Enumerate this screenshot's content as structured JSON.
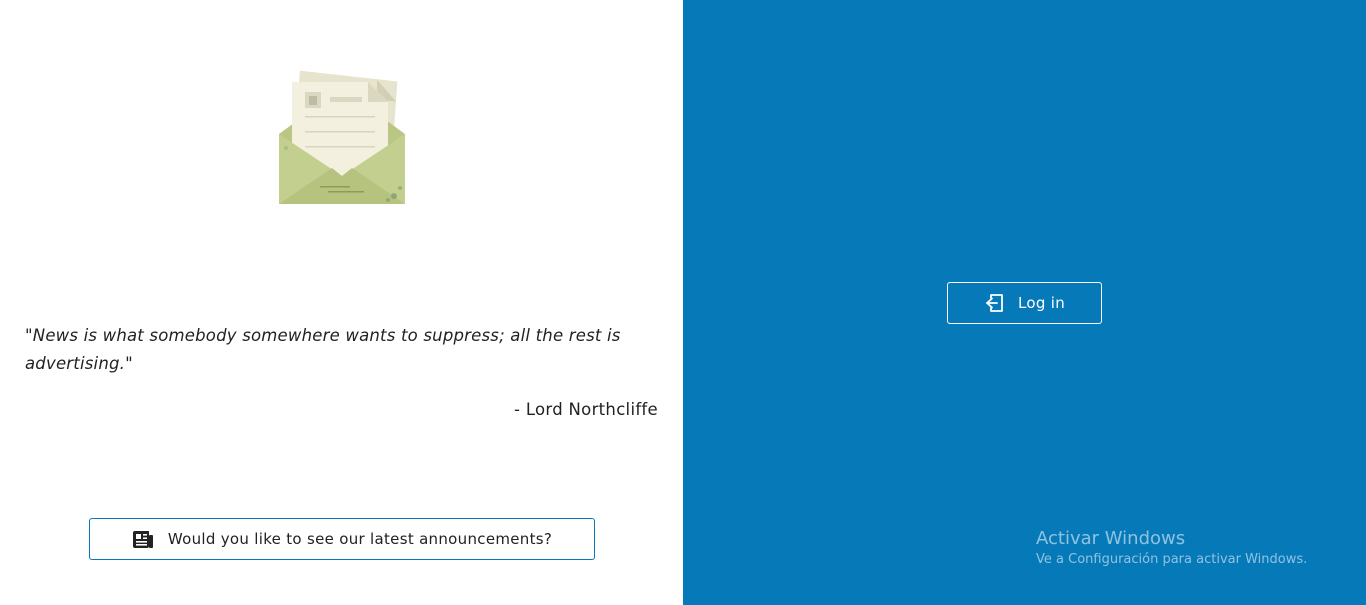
{
  "quote": {
    "text": "\"News is what somebody somewhere wants to suppress; all the rest is advertising.\"",
    "author": "- Lord Northcliffe"
  },
  "announcements": {
    "button_label": "Would you like to see our latest announcements?",
    "icon": "newspaper-icon"
  },
  "login": {
    "button_label": "Log in",
    "icon": "login-icon"
  },
  "watermark": {
    "title": "Activar Windows",
    "subtitle": "Ve a Configuración para activar Windows."
  },
  "colors": {
    "brand_blue": "#0679b9",
    "text": "#222222",
    "envelope_green": "#c3cf8f",
    "paper": "#f3f0df"
  }
}
